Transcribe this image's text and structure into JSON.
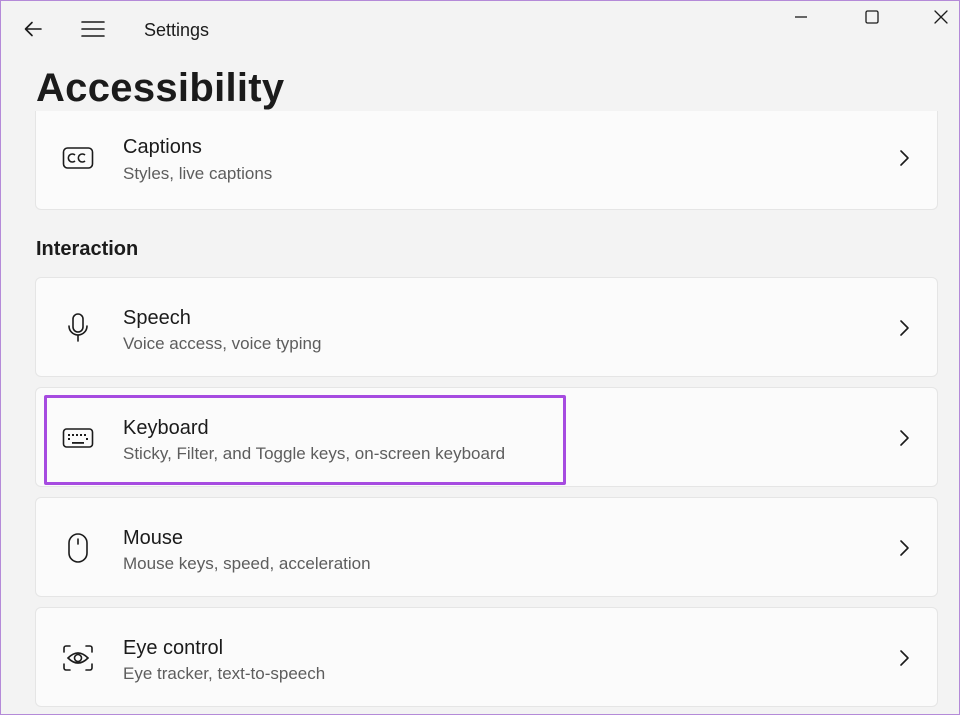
{
  "window": {
    "app_title": "Settings",
    "controls": [
      "minimize-icon",
      "maximize-icon",
      "close-icon"
    ]
  },
  "page": {
    "title": "Accessibility"
  },
  "items_top": [
    {
      "title": "Captions",
      "subtitle": "Styles, live captions",
      "icon": "cc-icon"
    }
  ],
  "section": {
    "title": "Interaction"
  },
  "items": [
    {
      "title": "Speech",
      "subtitle": "Voice access, voice typing",
      "icon": "microphone-icon"
    },
    {
      "title": "Keyboard",
      "subtitle": "Sticky, Filter, and Toggle keys, on-screen keyboard",
      "icon": "keyboard-icon"
    },
    {
      "title": "Mouse",
      "subtitle": "Mouse keys, speed, acceleration",
      "icon": "mouse-icon"
    },
    {
      "title": "Eye control",
      "subtitle": "Eye tracker, text-to-speech",
      "icon": "eye-tracker-icon"
    }
  ],
  "colors": {
    "highlight": "#a64be0",
    "background": "#f3f3f3",
    "card": "#fbfbfb"
  }
}
